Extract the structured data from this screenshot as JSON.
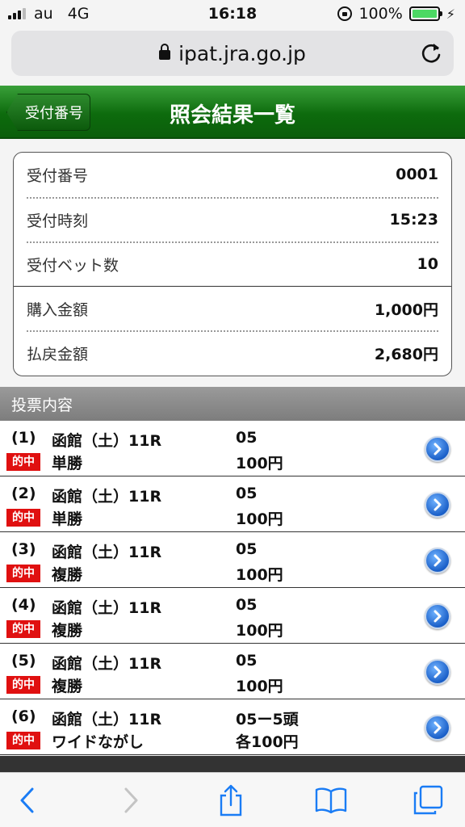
{
  "status": {
    "carrier": "au",
    "network": "4G",
    "time": "16:18",
    "battery": "100%",
    "battery_level": 1.0
  },
  "browser": {
    "url": "ipat.jra.go.jp"
  },
  "header": {
    "back_label": "受付番号",
    "title": "照会結果一覧"
  },
  "summary": {
    "rows": [
      {
        "label": "受付番号",
        "value": "0001"
      },
      {
        "label": "受付時刻",
        "value": "15:23"
      },
      {
        "label": "受付ベット数",
        "value": "10"
      },
      {
        "label": "購入金額",
        "value": "1,000円"
      },
      {
        "label": "払戻金額",
        "value": "2,680円"
      }
    ]
  },
  "section_title": "投票内容",
  "bets": [
    {
      "num": "(1)",
      "venue": "函館（土）11R",
      "combo": "05",
      "badge": "的中",
      "type": "単勝",
      "amount": "100円"
    },
    {
      "num": "(2)",
      "venue": "函館（土）11R",
      "combo": "05",
      "badge": "的中",
      "type": "単勝",
      "amount": "100円"
    },
    {
      "num": "(3)",
      "venue": "函館（土）11R",
      "combo": "05",
      "badge": "的中",
      "type": "複勝",
      "amount": "100円"
    },
    {
      "num": "(4)",
      "venue": "函館（土）11R",
      "combo": "05",
      "badge": "的中",
      "type": "複勝",
      "amount": "100円"
    },
    {
      "num": "(5)",
      "venue": "函館（土）11R",
      "combo": "05",
      "badge": "的中",
      "type": "複勝",
      "amount": "100円"
    },
    {
      "num": "(6)",
      "venue": "函館（土）11R",
      "combo": "05ー5頭",
      "badge": "的中",
      "type": "ワイドながし",
      "amount": "各100円"
    }
  ],
  "colors": {
    "header_green": "#0d6b0d",
    "hit_red": "#e01010",
    "arrow_blue": "#1a5fc8"
  }
}
